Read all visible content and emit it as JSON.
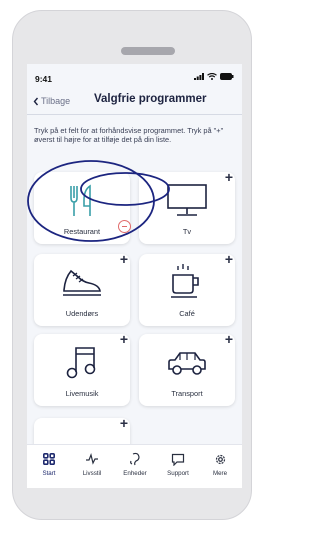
{
  "status": {
    "time": "9:41"
  },
  "header": {
    "back_label": "Tilbage",
    "title": "Valgfrie programmer"
  },
  "instructions": "Tryk på et felt for at forhåndsvise programmet. Tryk på \"+\" øverst til højre for at tilføje det på din liste.",
  "programs": [
    {
      "label": "Restaurant",
      "icon": "cutlery-icon",
      "action": "remove"
    },
    {
      "label": "Tv",
      "icon": "tv-icon",
      "action": "add"
    },
    {
      "label": "Udendørs",
      "icon": "shoe-icon",
      "action": "add"
    },
    {
      "label": "Café",
      "icon": "coffee-cup-icon",
      "action": "add"
    },
    {
      "label": "Livemusik",
      "icon": "music-note-icon",
      "action": "add"
    },
    {
      "label": "Transport",
      "icon": "car-icon",
      "action": "add"
    },
    {
      "label": "",
      "icon": "",
      "action": "add"
    }
  ],
  "tabs": [
    {
      "label": "Start",
      "icon": "grid-icon",
      "active": true
    },
    {
      "label": "Livsstil",
      "icon": "activity-icon",
      "active": false
    },
    {
      "label": "Enheder",
      "icon": "hearing-aid-icon",
      "active": false
    },
    {
      "label": "Support",
      "icon": "chat-icon",
      "active": false
    },
    {
      "label": "Mere",
      "icon": "gear-icon",
      "active": false
    }
  ],
  "colors": {
    "accent": "#1f2a6e",
    "remove": "#e06b6b",
    "teal": "#3a9fa8",
    "background": "#f4f6fa"
  }
}
